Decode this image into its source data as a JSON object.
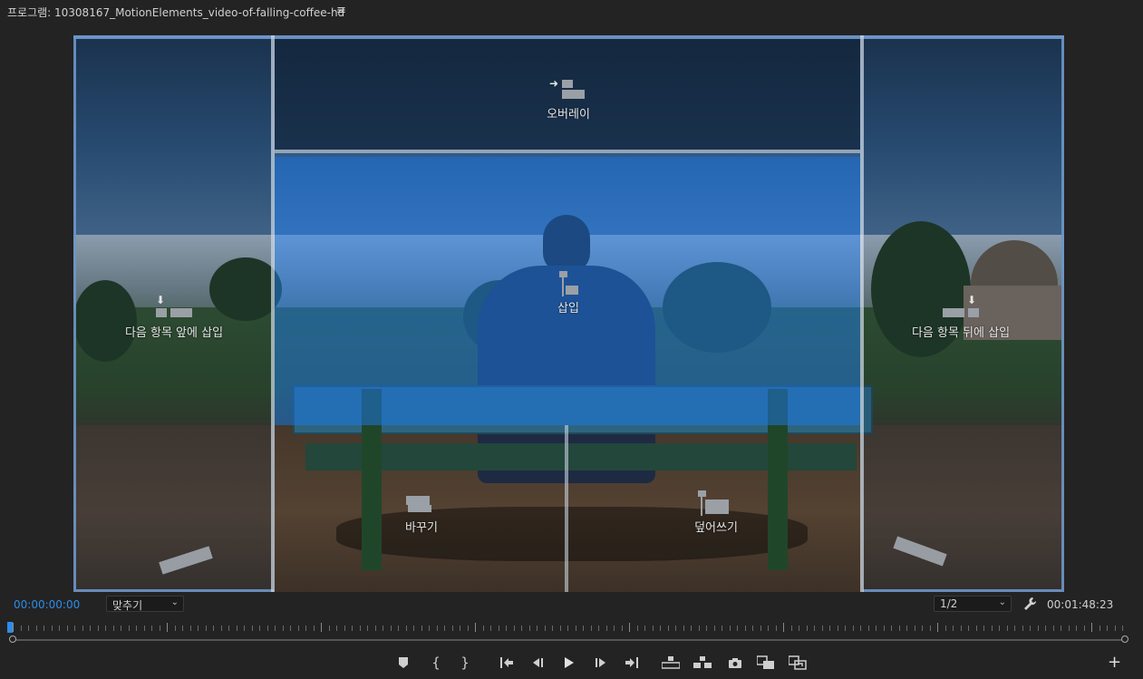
{
  "panel": {
    "title": "프로그램: 10308167_MotionElements_video-of-falling-coffee-hd",
    "menu_icon": "hamburger-icon"
  },
  "drop_zones": {
    "overlay": "오버레이",
    "insert": "삽입",
    "insert_before": "다음 항목 앞에 삽입",
    "insert_after": "다음 항목 뒤에 삽입",
    "replace": "바꾸기",
    "overwrite": "덮어쓰기"
  },
  "status": {
    "timecode_current": "00:00:00:00",
    "fit": "맞추기",
    "resolution": "1/2",
    "timecode_duration": "00:01:48:23"
  },
  "colors": {
    "timecode_accent": "#2d8ceb",
    "insert_zone": "#1e6ed2",
    "zone_border": "#6e96c8"
  },
  "transport_icons": [
    "add-marker-icon",
    "mark-in-icon",
    "mark-out-icon",
    "go-to-in-icon",
    "step-back-icon",
    "play-icon",
    "step-forward-icon",
    "go-to-out-icon",
    "lift-icon",
    "extract-icon",
    "export-frame-icon",
    "insert-icon",
    "overwrite-icon",
    "button-editor-plus-icon"
  ]
}
